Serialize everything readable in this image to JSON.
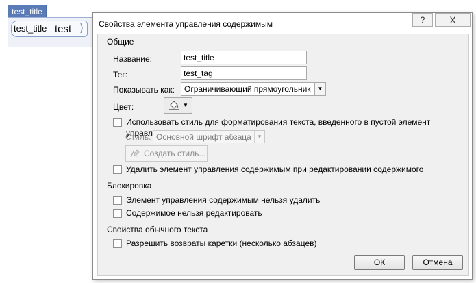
{
  "document": {
    "control_tab_title": "test_title",
    "control_inline_title": "test_title",
    "control_value": "test"
  },
  "dialog": {
    "title": "Свойства элемента управления содержимым",
    "help_label": "?",
    "close_label": "X",
    "general": {
      "heading": "Общие",
      "name_label": "Название:",
      "name_value": "test_title",
      "tag_label": "Тег:",
      "tag_value": "test_tag",
      "show_as_label": "Показывать как:",
      "show_as_value": "Ограничивающий прямоугольник",
      "color_label": "Цвет:",
      "use_style_label": "Использовать стиль для форматирования текста, введенного в пустой элемент управления",
      "style_label": "Стиль:",
      "style_value": "Основной шрифт абзаца",
      "new_style_button": "Создать стиль...",
      "remove_on_edit_label": "Удалить элемент управления содержимым при редактировании содержимого"
    },
    "locking": {
      "heading": "Блокировка",
      "cannot_delete_label": "Элемент управления содержимым нельзя удалить",
      "cannot_edit_label": "Содержимое нельзя редактировать"
    },
    "plain_text": {
      "heading": "Свойства обычного текста",
      "allow_carriage_returns_label": "Разрешить возвраты каретки (несколько абзацев)"
    },
    "ok_button": "ОК",
    "cancel_button": "Отмена"
  },
  "icons": {
    "color_picker": "paint-bucket-icon",
    "new_style": "new-style-icon",
    "dropdown": "chevron-down-icon"
  },
  "colors": {
    "control_tab": "#5b7bb7",
    "dialog_body": "#f0f0f0",
    "section_divider": "#d5dfe5"
  }
}
